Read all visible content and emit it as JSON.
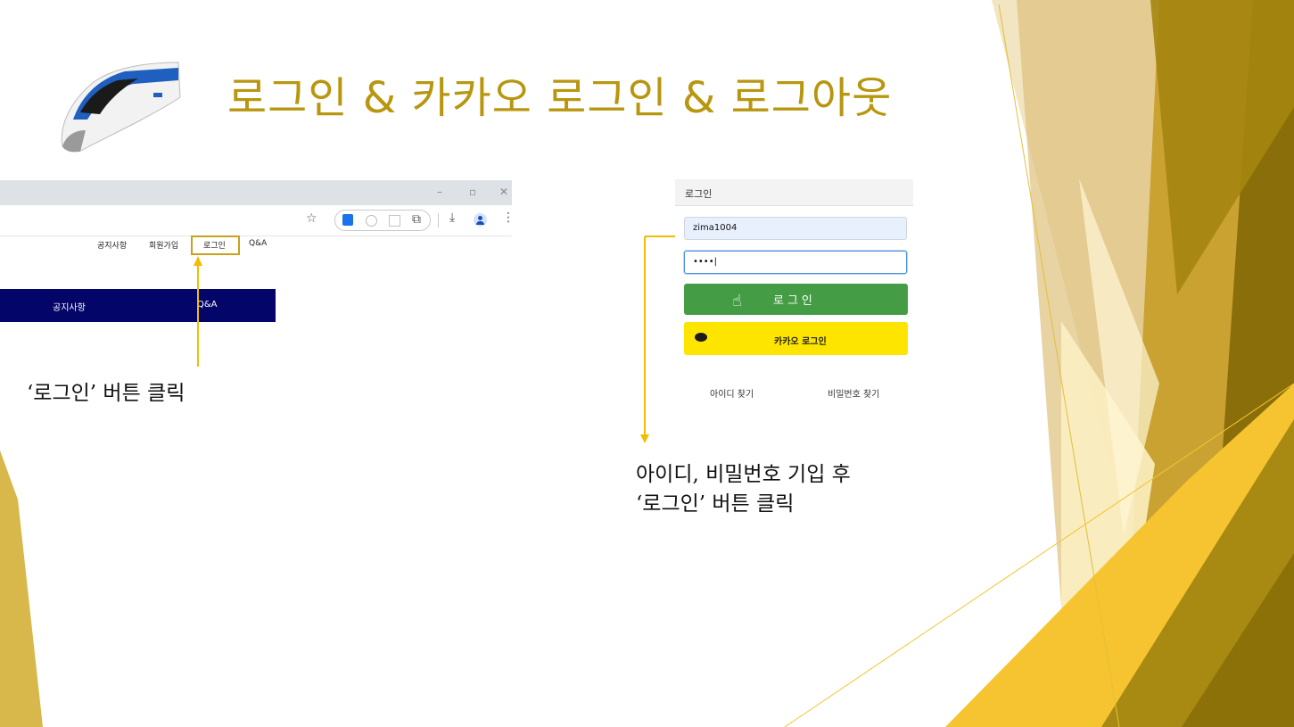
{
  "slide": {
    "title": "로그인 & 카카오 로그인 & 로그아웃",
    "accent_color": "#b8960f",
    "highlight_color": "#f2bd00"
  },
  "illustration": {
    "name": "ktx-train-image"
  },
  "browser": {
    "window_controls": [
      "–",
      "▫",
      "✕"
    ],
    "toolbar_icons": [
      "star-icon",
      "download-ext-icon",
      "timer-ext-icon",
      "square-ext-icon",
      "puzzle-icon",
      "download-icon",
      "profile-icon",
      "menu-icon"
    ],
    "nav": {
      "notice": "공지사항",
      "signup": "회원가입",
      "login": "로그인",
      "qna": "Q&A"
    },
    "menu_bar": {
      "notice": "공지사항",
      "qna": "Q&A",
      "color": "#030569"
    }
  },
  "caption_left": "‘로그인’ 버튼 클릭",
  "login_panel": {
    "header": "로그인",
    "id_value": "zima1004",
    "password_value": "••••|",
    "login_button": "로그인",
    "kakao_button": "카카오 로그인",
    "find_id": "아이디 찾기",
    "find_password": "비밀번호 찾기",
    "login_color": "#449d44",
    "kakao_color": "#fee500"
  },
  "caption_right": {
    "line1": "아이디, 비밀번호 기입 후",
    "line2": "‘로그인’ 버튼 클릭"
  }
}
